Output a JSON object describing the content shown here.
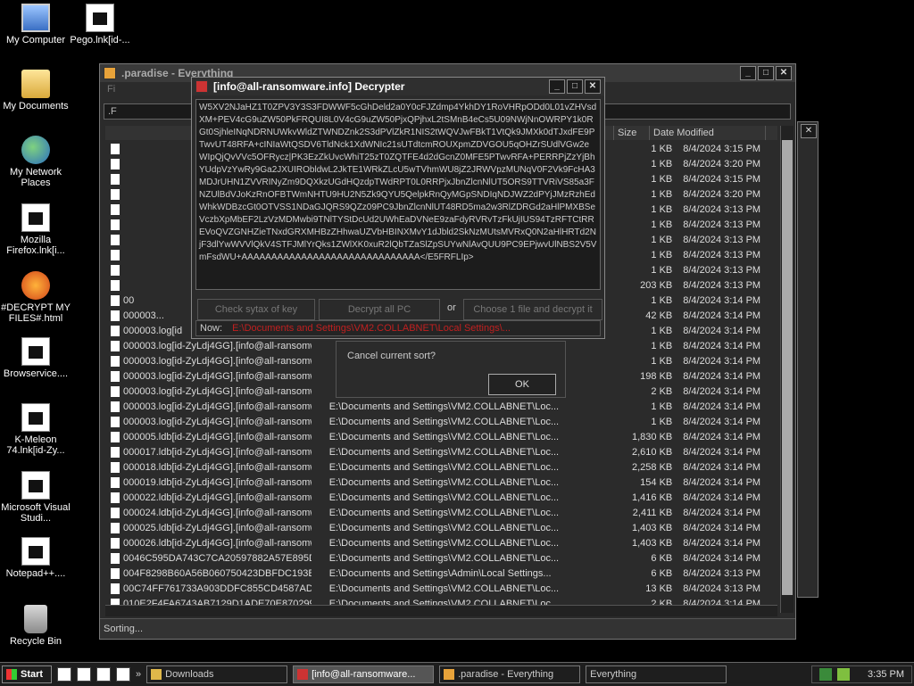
{
  "desktop_icons": [
    {
      "label": "My Computer",
      "icon": "computer-icon"
    },
    {
      "label": "Pego.lnk[id-...",
      "icon": "file-icon"
    },
    {
      "label": "My Documents",
      "icon": "folder-icon"
    },
    {
      "label": "My Network Places",
      "icon": "network-icon"
    },
    {
      "label": "Mozilla Firefox.lnk[i...",
      "icon": "file-icon"
    },
    {
      "label": "#DECRYPT MY FILES#.html",
      "icon": "firefox-icon"
    },
    {
      "label": "Browservice....",
      "icon": "file-icon"
    },
    {
      "label": "K-Meleon 74.lnk[id-Zy...",
      "icon": "file-icon"
    },
    {
      "label": "Microsoft Visual Studi...",
      "icon": "file-icon"
    },
    {
      "label": "Notepad++....",
      "icon": "file-icon"
    },
    {
      "label": "Recycle Bin",
      "icon": "recycle-bin-icon"
    }
  ],
  "everything": {
    "title": ".paradise - Everything",
    "menu": "Fi",
    "search": ".F",
    "columns": {
      "size": "Size",
      "date": "Date Modified"
    },
    "rows": [
      {
        "name": "",
        "path": "",
        "size": "1 KB",
        "date": "8/4/2024 3:15 PM"
      },
      {
        "name": "",
        "path": "",
        "size": "1 KB",
        "date": "8/4/2024 3:20 PM"
      },
      {
        "name": "",
        "path": "",
        "size": "1 KB",
        "date": "8/4/2024 3:15 PM"
      },
      {
        "name": "",
        "path": "",
        "size": "1 KB",
        "date": "8/4/2024 3:20 PM"
      },
      {
        "name": "",
        "path": "",
        "size": "1 KB",
        "date": "8/4/2024 3:13 PM"
      },
      {
        "name": "",
        "path": "",
        "size": "1 KB",
        "date": "8/4/2024 3:13 PM"
      },
      {
        "name": "",
        "path": "",
        "size": "1 KB",
        "date": "8/4/2024 3:13 PM"
      },
      {
        "name": "",
        "path": "",
        "size": "1 KB",
        "date": "8/4/2024 3:13 PM"
      },
      {
        "name": "",
        "path": "",
        "size": "1 KB",
        "date": "8/4/2024 3:13 PM"
      },
      {
        "name": "",
        "path": "",
        "size": "203 KB",
        "date": "8/4/2024 3:13 PM"
      },
      {
        "name": "00",
        "path": "",
        "size": "1 KB",
        "date": "8/4/2024 3:14 PM"
      },
      {
        "name": "000003...",
        "path": "",
        "size": "42 KB",
        "date": "8/4/2024 3:14 PM"
      },
      {
        "name": "000003.log[id",
        "path": "",
        "size": "1 KB",
        "date": "8/4/2024 3:14 PM"
      },
      {
        "name": "000003.log[id-ZyLdj4GG].[info@all-ransomwa...",
        "path": "",
        "size": "1 KB",
        "date": "8/4/2024 3:14 PM"
      },
      {
        "name": "000003.log[id-ZyLdj4GG].[info@all-ransomwa...",
        "path": "",
        "size": "1 KB",
        "date": "8/4/2024 3:14 PM"
      },
      {
        "name": "000003.log[id-ZyLdj4GG].[info@all-ransomwa...",
        "path": "",
        "size": "198 KB",
        "date": "8/4/2024 3:14 PM"
      },
      {
        "name": "000003.log[id-ZyLdj4GG].[info@all-ransomwa...",
        "path": "",
        "size": "2 KB",
        "date": "8/4/2024 3:14 PM"
      },
      {
        "name": "000003.log[id-ZyLdj4GG].[info@all-ransomwa...",
        "path": "E:\\Documents and Settings\\VM2.COLLABNET\\Loc...",
        "size": "1 KB",
        "date": "8/4/2024 3:14 PM"
      },
      {
        "name": "000003.log[id-ZyLdj4GG].[info@all-ransomwa...",
        "path": "E:\\Documents and Settings\\VM2.COLLABNET\\Loc...",
        "size": "1 KB",
        "date": "8/4/2024 3:14 PM"
      },
      {
        "name": "000005.ldb[id-ZyLdj4GG].[info@all-ransomwa...",
        "path": "E:\\Documents and Settings\\VM2.COLLABNET\\Loc...",
        "size": "1,830 KB",
        "date": "8/4/2024 3:14 PM"
      },
      {
        "name": "000017.ldb[id-ZyLdj4GG].[info@all-ransomwa...",
        "path": "E:\\Documents and Settings\\VM2.COLLABNET\\Loc...",
        "size": "2,610 KB",
        "date": "8/4/2024 3:14 PM"
      },
      {
        "name": "000018.ldb[id-ZyLdj4GG].[info@all-ransomwa...",
        "path": "E:\\Documents and Settings\\VM2.COLLABNET\\Loc...",
        "size": "2,258 KB",
        "date": "8/4/2024 3:14 PM"
      },
      {
        "name": "000019.ldb[id-ZyLdj4GG].[info@all-ransomwa...",
        "path": "E:\\Documents and Settings\\VM2.COLLABNET\\Loc...",
        "size": "154 KB",
        "date": "8/4/2024 3:14 PM"
      },
      {
        "name": "000022.ldb[id-ZyLdj4GG].[info@all-ransomwa...",
        "path": "E:\\Documents and Settings\\VM2.COLLABNET\\Loc...",
        "size": "1,416 KB",
        "date": "8/4/2024 3:14 PM"
      },
      {
        "name": "000024.ldb[id-ZyLdj4GG].[info@all-ransomwa...",
        "path": "E:\\Documents and Settings\\VM2.COLLABNET\\Loc...",
        "size": "2,411 KB",
        "date": "8/4/2024 3:14 PM"
      },
      {
        "name": "000025.ldb[id-ZyLdj4GG].[info@all-ransomwa...",
        "path": "E:\\Documents and Settings\\VM2.COLLABNET\\Loc...",
        "size": "1,403 KB",
        "date": "8/4/2024 3:14 PM"
      },
      {
        "name": "000026.ldb[id-ZyLdj4GG].[info@all-ransomwa...",
        "path": "E:\\Documents and Settings\\VM2.COLLABNET\\Loc...",
        "size": "1,403 KB",
        "date": "8/4/2024 3:14 PM"
      },
      {
        "name": "0046C595DA743C7CA20597882A57E895DF4...",
        "path": "E:\\Documents and Settings\\VM2.COLLABNET\\Loc...",
        "size": "6 KB",
        "date": "8/4/2024 3:14 PM"
      },
      {
        "name": "004F8298B60A56B060750423DBFDC193BE37...",
        "path": "E:\\Documents and Settings\\Admin\\Local Settings...",
        "size": "6 KB",
        "date": "8/4/2024 3:13 PM"
      },
      {
        "name": "00C74FF761733A903DDFC855CD4587ADDA...",
        "path": "E:\\Documents and Settings\\VM2.COLLABNET\\Loc...",
        "size": "13 KB",
        "date": "8/4/2024 3:13 PM"
      },
      {
        "name": "010E2F4FA6743AB7129D1ADE70E8702992...",
        "path": "E:\\Documents and Settings\\VM2.COLLABNET\\Loc...",
        "size": "2 KB",
        "date": "8/4/2024 3:14 PM"
      }
    ],
    "status": "Sorting..."
  },
  "decrypter": {
    "title": "[info@all-ransomware.info] Decrypter",
    "key_text": "W5XV2NJaHZ1T0ZPV3Y3S3FDWWF5cGhDeld2a0Y0cFJZdmp4YkhDY1RoVHRpODd0L01vZHVsdXM+PEV4cG9uZW50PkFRQUI8L0V4cG9uZW50PjxQPjhxL2tSMnB4eCs5U09NWjNnOWRPY1k0RGt0SjhleINqNDRNUWkvWldZTWNDZnk2S3dPVlZkR1NIS2tWQVJwFBkT1VtQk9JMXk0dTJxdFE9PTwvUT48RFA+cINIaWtQSDV6TldNck1XdWNIc21sUTdtcmROUXpmZDVGOU5qOHZrSUdlVGw2eWIpQjQvVVc5OFRycz|PK3EzZkUvcWhiT25zT0ZQTFE4d2dGcnZ0MFE5PTwvRFA+PERRPjZzYjBhYUdpVzYwRy9Ga2JXUIRObldwL2JkTE1WRkZLcU5wTVhmWU8jZ2JRWVpzMUNqV0F2Vk9FcHA3MDJrUHN1ZVVRINyZm9DQXkzUGdHQzdpTWdRPT0L0RRPjxJbnZlcnNlUT5ORS9TTVRiVS85a3FNZUlBdVJoKzRnOFBTWmNHTU9HU2N5Zk9QYU5QelpkRnQyMGpSNDIqNDJWZ2dPYjJMzRzhEdWhkWDBzcGt0OTVSS1NDaGJQRS9QZz09PC9JbnZlcnNlUT48RD5ma2w3RlZDRGd2aHlPMXBSeVczbXpMbEF2LzVzMDMwbi9TNlTYStDcUd2UWhEaDVNeE9zaFdyRVRvTzFkUjIUS94TzRFTCtRREVoQVZGNHZieTNxdGRXMHBzZHhwaUZVbHBINXMvY1dJbld2SkNzMUtsMVRxQ0N2aHlHRTd2NjF3dlYwWVVlQkV4STFJMlYrQks1ZWlXK0xuR2lQbTZaSlZpSUYwNlAvQUU9PC9EPjwvUlNBS2V5VmFsdWU+AAAAAAAAAAAAAAAAAAAAAAAAAAAAAA</E5FRFLIp>",
    "btn_check": "Check sytax of key",
    "btn_decrypt_all": "Decrypt all PC",
    "or": "or",
    "btn_choose": "Choose 1 file and decrypt it",
    "now_label": "Now:",
    "now_value": "E:\\Documents and Settings\\VM2.COLLABNET\\Local Settings\\..."
  },
  "sort_dialog": {
    "message": "Cancel current sort?",
    "ok": "OK"
  },
  "taskbar": {
    "start": "Start",
    "more": "»",
    "tasks": [
      {
        "label": "Downloads",
        "icon": "folder-icon"
      },
      {
        "label": "[info@all-ransomware...",
        "icon": "decrypter-icon",
        "active": true
      },
      {
        "label": ".paradise - Everything",
        "icon": "everything-icon"
      },
      {
        "label": "Everything",
        "icon": "everything-icon"
      }
    ],
    "clock": "3:35 PM"
  }
}
